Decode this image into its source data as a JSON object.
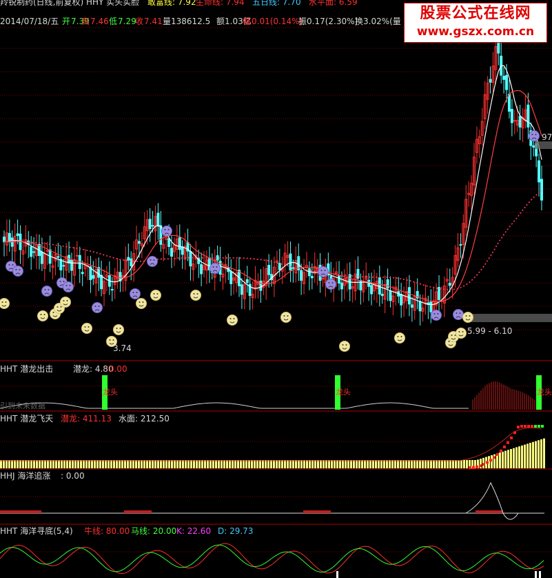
{
  "header": {
    "title_left": "羚锐制药(日线,前复权) HHY 实头实脸",
    "gan_label": "敢富线: 7.92",
    "sheng_label": "生命线: 7.94",
    "wuri_label": "五日线: 7.70",
    "shui_label": "水平面: 6.59",
    "date": "2014/07/18/五",
    "open_l": "开",
    "open_v": "7.39",
    "high_l": "高",
    "high_v": "7.46",
    "low_l": "低",
    "low_v": "7.29",
    "close_l": "收",
    "close_v": "7.41",
    "vol": "量138612.5",
    "amt": "额1.03亿",
    "fu_l": "幅",
    "fu_v": "0.01(0.14%)",
    "zhen": "振0.17(2.30%)",
    "huan": "换3.02%(量"
  },
  "watermark": {
    "line1": "股票公式在线网",
    "line2": "www.gszx.com.cn"
  },
  "main_chart": {
    "price_low_label": "3.74",
    "range_label": "5.99 - 6.10",
    "right_price_label": "97"
  },
  "panel1": {
    "title": "HHT 潜龙出击",
    "val1": "潜龙: 4.80",
    "val2": ": 0.00",
    "markers": [
      "龙头",
      "龙头",
      "龙头"
    ],
    "future_label": "引到未来数据"
  },
  "panel2": {
    "title": "HHT 潜龙飞天",
    "val1": "潜龙: 411.13",
    "val2": "水面: 212.50"
  },
  "panel3": {
    "title": "HHJ 海洋追涨",
    "val1": ": 0.00"
  },
  "panel4": {
    "title": "HHT 海洋寻底(5,4)",
    "val1": "牛线: 80.00",
    "val2": "马线: 20.00",
    "val3": "K: 22.60",
    "val4": "D: 29.73"
  },
  "colors": {
    "up": "#ff3232",
    "down": "#54ffff",
    "ma1": "#ffffff",
    "ma2": "#ff4040",
    "grid": "#800000"
  },
  "chart_data": {
    "type": "candlestick",
    "title": "羚锐制药(日线,前复权)",
    "close_series": [
      7.0,
      7.1,
      6.9,
      6.8,
      6.6,
      6.5,
      6.4,
      6.3,
      6.4,
      6.2,
      6.0,
      5.8,
      5.7,
      5.9,
      6.3,
      6.8,
      7.4,
      7.7,
      7.0,
      6.8,
      6.9,
      6.5,
      6.3,
      6.2,
      6.3,
      6.1,
      5.9,
      5.6,
      5.5,
      5.7,
      6.0,
      6.2,
      6.5,
      6.2,
      6.0,
      6.1,
      6.0,
      5.9,
      5.8,
      5.7,
      5.8,
      5.7,
      5.6,
      5.5,
      5.4,
      5.3,
      5.2,
      5.1,
      5.0,
      5.2,
      5.5,
      6.1,
      7.4,
      9.0,
      10.5,
      12.0,
      13.0,
      11.5,
      10.5,
      11.0,
      10.0,
      8.5
    ],
    "low_label": 3.74,
    "range": [
      5.99,
      6.1
    ],
    "last": {
      "date": "2014/07/18",
      "open": 7.39,
      "high": 7.46,
      "low": 7.29,
      "close": 7.41
    }
  }
}
